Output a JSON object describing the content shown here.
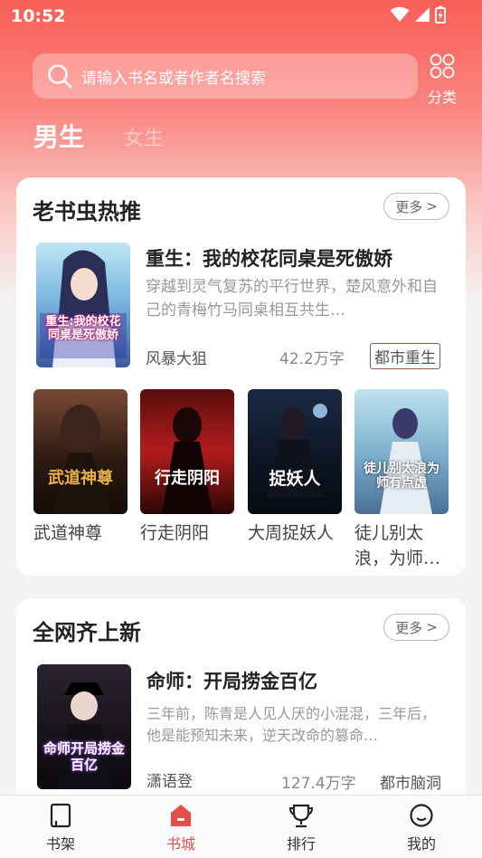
{
  "status_bar": {
    "time": "10:52"
  },
  "search": {
    "placeholder": "请输入书名或者作者名搜索",
    "category_label": "分类"
  },
  "gender_tabs": {
    "male": "男生",
    "female": "女生"
  },
  "section_hot": {
    "title": "老书虫热推",
    "more": "更多",
    "featured": {
      "title": "重生：我的校花同桌是死傲娇",
      "desc": "穿越到灵气复苏的平行世界，楚风意外和自己的青梅竹马同桌相互共生…",
      "author": "风暴大狙",
      "word_count": "42.2万字",
      "tag": "都市重生",
      "cover_text": "重生:我的校花同桌是死傲娇"
    },
    "books": [
      {
        "title": "武道神尊",
        "cover_text": "武道神尊"
      },
      {
        "title": "行走阴阳",
        "cover_text": "行走阴阳"
      },
      {
        "title": "大周捉妖人",
        "cover_text": "捉妖人"
      },
      {
        "title": "徒儿别太浪，为师…",
        "cover_text": "徒儿别太浪为师有点虚"
      }
    ]
  },
  "section_new": {
    "title": "全网齐上新",
    "more": "更多",
    "featured": {
      "title": "命师：开局捞金百亿",
      "desc": "三年前，陈青是人见人厌的小混混，三年后，他是能预知未来，逆天改命的篡命…",
      "author": "潇语登",
      "word_count": "127.4万字",
      "tag": "都市脑洞",
      "cover_text": "命师开局捞金百亿"
    }
  },
  "bottom_nav": [
    {
      "label": "书架",
      "icon": "bookshelf-icon"
    },
    {
      "label": "书城",
      "icon": "bookstore-icon",
      "active": true
    },
    {
      "label": "排行",
      "icon": "trophy-icon"
    },
    {
      "label": "我的",
      "icon": "profile-icon"
    }
  ],
  "colors": {
    "accent": "#e64f48",
    "header_top": "#f95f57"
  }
}
